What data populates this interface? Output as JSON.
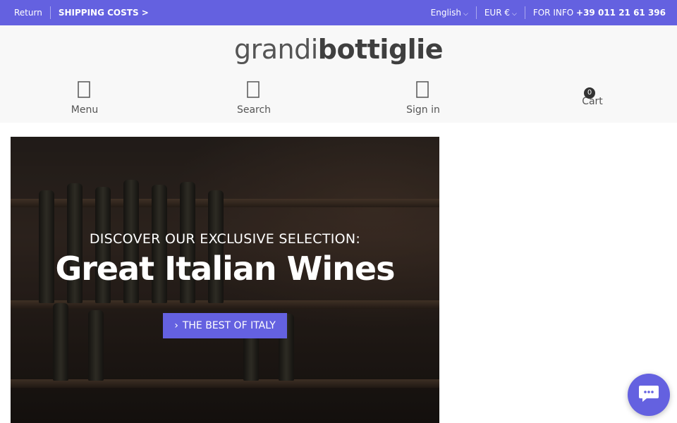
{
  "topbar": {
    "return_label": "Return",
    "shipping_label": "SHIPPING COSTS >",
    "language": "English",
    "currency": "EUR €",
    "info_prefix": "FOR INFO",
    "phone": "+39 011 21 61 396",
    "background_color": "#6461e0"
  },
  "header": {
    "logo_light": "grandi",
    "logo_heavy": "bottiglie",
    "nav": [
      {
        "label": "Menu",
        "icon": "menu-icon"
      },
      {
        "label": "Search",
        "icon": "search-icon"
      },
      {
        "label": "Sign in",
        "icon": "user-icon"
      }
    ],
    "cart": {
      "label": "Cart",
      "count": "0",
      "icon": "cart-icon"
    }
  },
  "hero": {
    "subtitle": "DISCOVER OUR EXCLUSIVE SELECTION:",
    "title": "Great Italian Wines",
    "button_label": "THE BEST OF ITALY",
    "button_icon": "chevron-right-icon",
    "accent_color": "#6461e0"
  },
  "chat": {
    "icon": "chat-icon"
  }
}
